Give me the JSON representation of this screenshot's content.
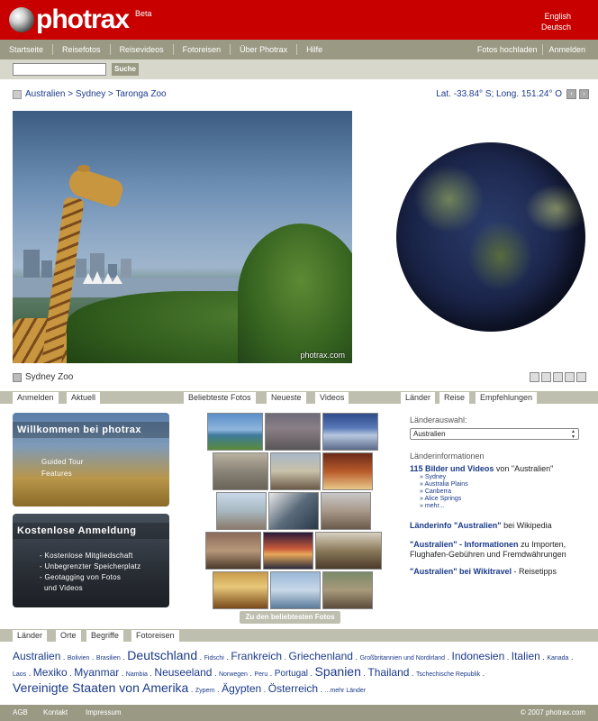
{
  "header": {
    "logo_text": "photrax",
    "beta": "Beta",
    "lang_en": "English",
    "lang_de": "Deutsch",
    "brand_color": "#c80000"
  },
  "nav": {
    "items": [
      "Startseite",
      "Reisefotos",
      "Reisevideos",
      "Fotoreisen",
      "Über Photrax",
      "Hilfe"
    ],
    "upload": "Fotos hochladen",
    "login": "Anmelden"
  },
  "search": {
    "placeholder": "",
    "button": "Suche"
  },
  "breadcrumb": "Australien > Sydney > Taronga Zoo",
  "coords": "Lat. -33.84° S; Long. 151.24° O",
  "photo": {
    "watermark": "photrax.com",
    "caption": "Sydney Zoo"
  },
  "tabs_left": [
    "Anmelden",
    "Aktuell"
  ],
  "tabs_mid": [
    "Beliebteste Fotos",
    "Neueste",
    "Videos"
  ],
  "tabs_right": [
    "Länder",
    "Reise",
    "Empfehlungen"
  ],
  "promo1": {
    "title": "Willkommen bei photrax",
    "lines": [
      "Guided Tour",
      "Features"
    ]
  },
  "promo2": {
    "title": "Kostenlose Anmeldung",
    "lines": [
      "- Kostenlose Mitgliedschaft",
      "- Unbegrenzter Speicherplatz",
      "- Geotagging von Fotos",
      "  und Videos"
    ]
  },
  "popular_button": "Zu den beliebtesten Fotos",
  "right": {
    "country_select_label": "Länderauswahl:",
    "country_selected": "Australien",
    "country_info_label": "Länderinformationen",
    "count_bold": "115 Bilder und Videos",
    "count_rest": "von \"Australien\"",
    "sublinks": [
      "» Sydney",
      "» Australia Plains",
      "» Canberra",
      "» Alice Springs",
      "» mehr..."
    ],
    "wiki_bold": "Länderinfo \"Australien\"",
    "wiki_rest": "bei Wikipedia",
    "info_bold": "\"Australien\" - Informationen",
    "info_rest": "zu Importen,",
    "info_line2": "Flughafen-Gebühren und Fremdwährungen",
    "wikitravel_bold": "\"Australien\" bei Wikitravel",
    "wikitravel_rest": "- Reisetipps"
  },
  "bottom_tabs": [
    "Länder",
    "Orte",
    "Begriffe",
    "Fotoreisen"
  ],
  "countries": [
    {
      "name": "Australien",
      "size": "l"
    },
    {
      "name": "Bolivien",
      "size": "s"
    },
    {
      "name": "Brasilien",
      "size": "s"
    },
    {
      "name": "Deutschland",
      "size": "xl"
    },
    {
      "name": "Fidschi",
      "size": "s"
    },
    {
      "name": "Frankreich",
      "size": "l"
    },
    {
      "name": "Griechenland",
      "size": "l"
    },
    {
      "name": "Großbritannien und Nordirland",
      "size": "s"
    },
    {
      "name": "Indonesien",
      "size": "l"
    },
    {
      "name": "Italien",
      "size": "l"
    },
    {
      "name": "Kanada",
      "size": "s"
    },
    {
      "name": "Laos",
      "size": "s"
    },
    {
      "name": "Mexiko",
      "size": "l"
    },
    {
      "name": "Myanmar",
      "size": "l"
    },
    {
      "name": "Nambia",
      "size": "s"
    },
    {
      "name": "Neuseeland",
      "size": "l"
    },
    {
      "name": "Norwegen",
      "size": "s"
    },
    {
      "name": "Peru",
      "size": "s"
    },
    {
      "name": "Portugal",
      "size": "m"
    },
    {
      "name": "Spanien",
      "size": "xl"
    },
    {
      "name": "Thailand",
      "size": "l"
    },
    {
      "name": "Tschechische Republik",
      "size": "s"
    },
    {
      "name": "Vereinigte Staaten von Amerika",
      "size": "xl"
    },
    {
      "name": "Zypern",
      "size": "s"
    },
    {
      "name": "Ägypten",
      "size": "l"
    },
    {
      "name": "Österreich",
      "size": "l"
    },
    {
      "name": "...mehr Länder",
      "size": "s"
    }
  ],
  "footer": {
    "agb": "AGB",
    "kontakt": "Kontakt",
    "impressum": "Impressum",
    "copyright": "© 2007 photrax.com"
  },
  "icons": [
    "photrax-logo-icon",
    "map-icon",
    "prev-arrow-icon",
    "next-arrow-icon",
    "photo-tool-icons",
    "select-arrows-icon"
  ]
}
